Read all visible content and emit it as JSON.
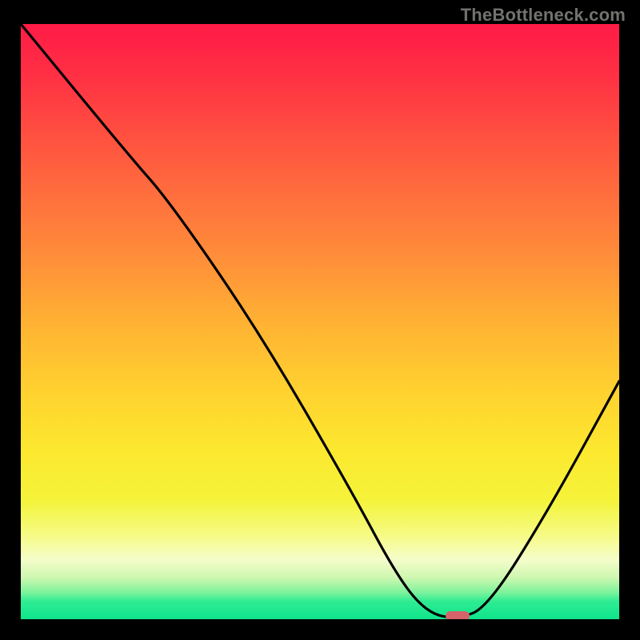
{
  "watermark": "TheBottleneck.com",
  "chart_data": {
    "type": "line",
    "title": "",
    "xlabel": "",
    "ylabel": "",
    "xlim": [
      0,
      1
    ],
    "ylim": [
      0,
      1
    ],
    "series": [
      {
        "name": "bottleneck-curve",
        "points": [
          {
            "x": 0.0,
            "y": 1.0
          },
          {
            "x": 0.18,
            "y": 0.78
          },
          {
            "x": 0.25,
            "y": 0.7
          },
          {
            "x": 0.4,
            "y": 0.48
          },
          {
            "x": 0.55,
            "y": 0.22
          },
          {
            "x": 0.63,
            "y": 0.07
          },
          {
            "x": 0.68,
            "y": 0.01
          },
          {
            "x": 0.73,
            "y": 0.0
          },
          {
            "x": 0.78,
            "y": 0.02
          },
          {
            "x": 0.88,
            "y": 0.18
          },
          {
            "x": 1.0,
            "y": 0.4
          }
        ]
      }
    ],
    "optimal_marker": {
      "x": 0.73,
      "y": 0.0
    },
    "background_gradient": {
      "top_color": "#ff1b47",
      "bottom_color": "#0fe58c"
    }
  }
}
